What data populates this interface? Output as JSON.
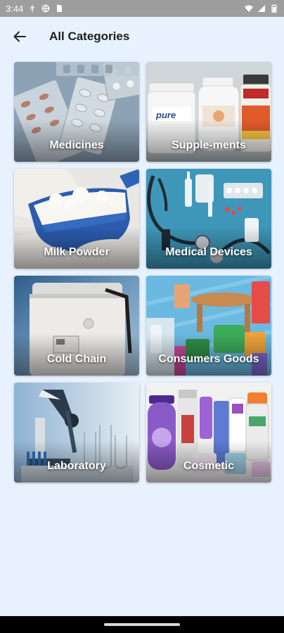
{
  "status_bar": {
    "time": "3:44",
    "icons": [
      "usb-icon",
      "target-icon",
      "sim-icon",
      "wifi-icon",
      "signal-icon",
      "battery-icon"
    ]
  },
  "header": {
    "back_icon": "arrow-left-icon",
    "title": "All Categories"
  },
  "categories": [
    {
      "label": "Medicines"
    },
    {
      "label": "Supple-ments"
    },
    {
      "label": "Milk Powder"
    },
    {
      "label": "Medical Devices"
    },
    {
      "label": "Cold Chain"
    },
    {
      "label": "Consumers Goods"
    },
    {
      "label": "Laboratory"
    },
    {
      "label": "Cosmetic"
    }
  ],
  "colors": {
    "background": "#e8f2fe",
    "status_bar": "#9e9e9e",
    "nav_bar": "#000000"
  }
}
